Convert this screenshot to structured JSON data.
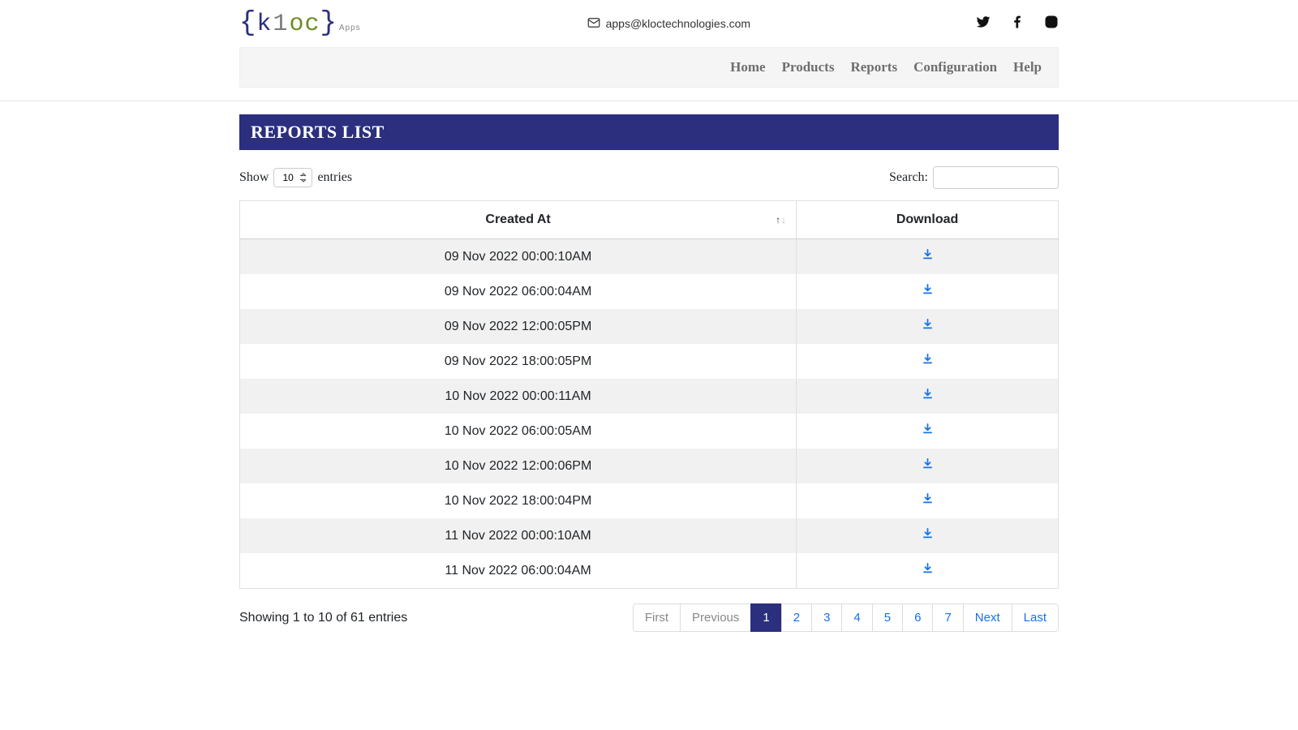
{
  "header": {
    "email": "apps@kloctechnologies.com",
    "logo": {
      "k": "k",
      "one": "1",
      "oc": "oc",
      "suffix": "Apps"
    }
  },
  "nav": {
    "items": [
      "Home",
      "Products",
      "Reports",
      "Configuration",
      "Help"
    ]
  },
  "page": {
    "title": "REPORTS LIST"
  },
  "controls": {
    "show_label_pre": "Show",
    "show_label_post": "entries",
    "page_size": "10",
    "search_label": "Search:"
  },
  "table": {
    "columns": {
      "created_at": "Created At",
      "download": "Download"
    },
    "rows": [
      {
        "created_at": "09 Nov 2022 00:00:10AM"
      },
      {
        "created_at": "09 Nov 2022 06:00:04AM"
      },
      {
        "created_at": "09 Nov 2022 12:00:05PM"
      },
      {
        "created_at": "09 Nov 2022 18:00:05PM"
      },
      {
        "created_at": "10 Nov 2022 00:00:11AM"
      },
      {
        "created_at": "10 Nov 2022 06:00:05AM"
      },
      {
        "created_at": "10 Nov 2022 12:00:06PM"
      },
      {
        "created_at": "10 Nov 2022 18:00:04PM"
      },
      {
        "created_at": "11 Nov 2022 00:00:10AM"
      },
      {
        "created_at": "11 Nov 2022 06:00:04AM"
      }
    ],
    "info": "Showing 1 to 10 of 61 entries"
  },
  "pagination": {
    "first": "First",
    "previous": "Previous",
    "pages": [
      "1",
      "2",
      "3",
      "4",
      "5",
      "6",
      "7"
    ],
    "active": "1",
    "next": "Next",
    "last": "Last"
  }
}
